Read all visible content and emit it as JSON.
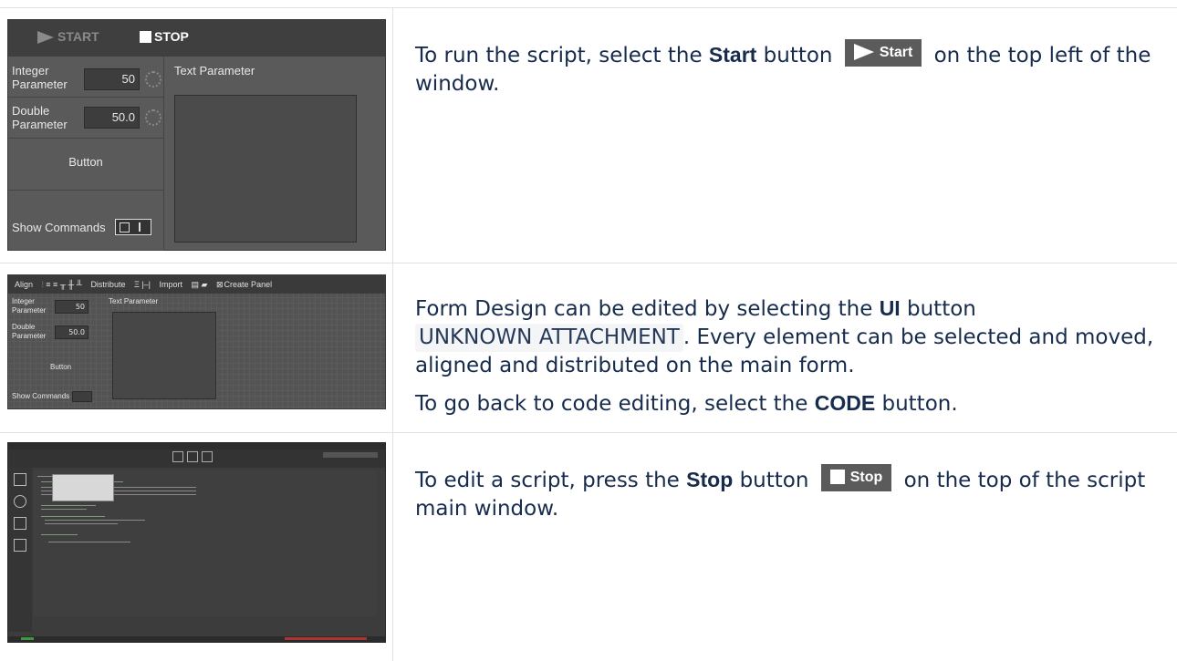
{
  "rows": [
    {
      "text_before": "To run the script, select the ",
      "bold": "Start",
      "text_mid": " button ",
      "inline_button": "Start",
      "text_after": " on the top left of the window.",
      "screenshot": {
        "start_label": "START",
        "stop_label": "STOP",
        "integer_label_1": "Integer",
        "integer_label_2": "Parameter",
        "integer_value": "50",
        "double_label_1": "Double",
        "double_label_2": "Parameter",
        "double_value": "50.0",
        "button_label": "Button",
        "show_commands_label": "Show Commands",
        "text_param_label": "Text Parameter"
      }
    },
    {
      "text_before": "Form Design can be edited by selecting the ",
      "bold": "UI",
      "text_mid": " button ",
      "unknown": "UNKNOWN ATTACHMENT",
      "text_after": ". Every element can be selected and moved, aligned and distributed on the main form.",
      "para2_before": "To go back to code editing, select the ",
      "para2_bold": "CODE",
      "para2_after": " button.",
      "screenshot": {
        "align": "Align",
        "distribute": "Distribute",
        "import": "Import",
        "create_panel": "Create Panel",
        "integer_label_1": "Integer",
        "integer_label_2": "Parameter",
        "integer_value": "50",
        "double_label_1": "Double",
        "double_label_2": "Parameter",
        "double_value": "50.0",
        "button_label": "Button",
        "show_commands_label": "Show Commands",
        "text_param_label": "Text Parameter"
      }
    },
    {
      "text_before": "To edit a script, press the ",
      "bold": "Stop",
      "text_mid": " button ",
      "inline_button": "Stop",
      "text_after": " on the top of the script main window."
    }
  ]
}
